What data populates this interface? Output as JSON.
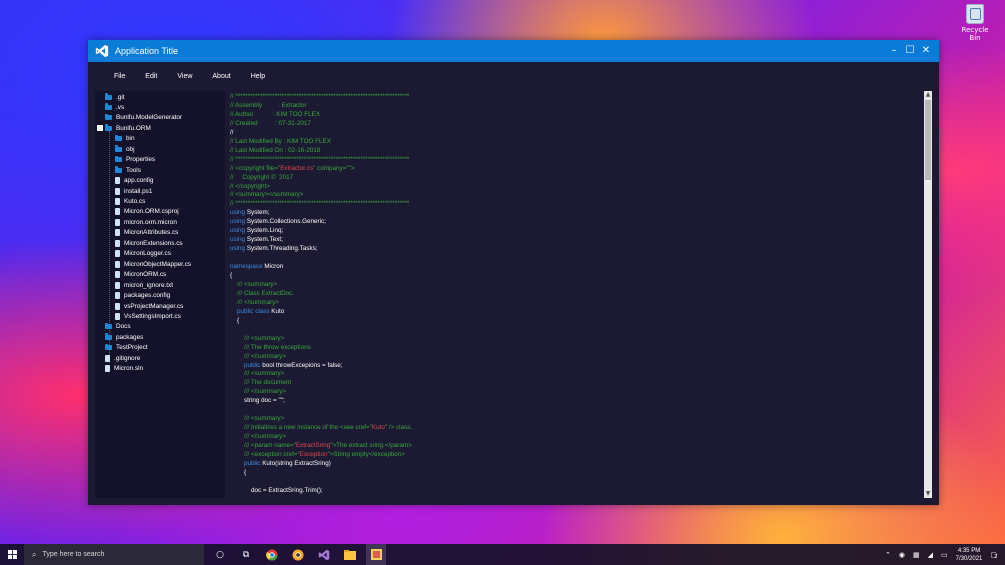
{
  "desktop": {
    "recycle_bin_label": "Recycle Bin"
  },
  "window": {
    "title": "Application Title",
    "icon": "visual-studio-icon",
    "controls": [
      "minimize-icon",
      "maximize-icon",
      "close-icon"
    ]
  },
  "menu": [
    "File",
    "Edit",
    "View",
    "About",
    "Help"
  ],
  "tree": [
    {
      "label": ".git",
      "type": "folder",
      "level": 0
    },
    {
      "label": ".vs",
      "type": "folder",
      "level": 0
    },
    {
      "label": "Bunifu.ModelGenerator",
      "type": "folder",
      "level": 0
    },
    {
      "label": "Bunifu.ORM",
      "type": "folder",
      "level": 0,
      "expanded": true
    },
    {
      "label": "bin",
      "type": "folder",
      "level": 1
    },
    {
      "label": "obj",
      "type": "folder",
      "level": 1
    },
    {
      "label": "Properties",
      "type": "folder",
      "level": 1
    },
    {
      "label": "Tools",
      "type": "folder",
      "level": 1
    },
    {
      "label": "app.config",
      "type": "file",
      "level": 1
    },
    {
      "label": "install.ps1",
      "type": "file",
      "level": 1
    },
    {
      "label": "Kuto.cs",
      "type": "file",
      "level": 1
    },
    {
      "label": "Micron.ORM.csproj",
      "type": "file",
      "level": 1
    },
    {
      "label": "micron.orm.micron",
      "type": "file",
      "level": 1
    },
    {
      "label": "MicronAttributes.cs",
      "type": "file",
      "level": 1
    },
    {
      "label": "MicronExtensions.cs",
      "type": "file",
      "level": 1
    },
    {
      "label": "MicronLogger.cs",
      "type": "file",
      "level": 1
    },
    {
      "label": "MicronObjectMapper.cs",
      "type": "file",
      "level": 1
    },
    {
      "label": "MicronORM.cs",
      "type": "file",
      "level": 1
    },
    {
      "label": "micron_ignore.txt",
      "type": "file",
      "level": 1
    },
    {
      "label": "packages.config",
      "type": "file",
      "level": 1
    },
    {
      "label": "vsProjectManager.cs",
      "type": "file",
      "level": 1
    },
    {
      "label": "VsSettingsImport.cs",
      "type": "file",
      "level": 1
    },
    {
      "label": "Docs",
      "type": "folder",
      "level": 0
    },
    {
      "label": "packages",
      "type": "folder",
      "level": 0
    },
    {
      "label": "TestProject",
      "type": "folder",
      "level": 0
    },
    {
      "label": ".gitignore",
      "type": "file",
      "level": 0
    },
    {
      "label": "Micron.sln",
      "type": "file",
      "level": 0
    }
  ],
  "code": [
    [
      [
        "c",
        "// ***********************************************************************"
      ]
    ],
    [
      [
        "c",
        "// Assembly         : Extractor"
      ]
    ],
    [
      [
        "c",
        "// Author           : KIM TOO FLEX"
      ]
    ],
    [
      [
        "c",
        "// Created          : 07-31-2017"
      ]
    ],
    [
      [
        "t",
        "//"
      ]
    ],
    [
      [
        "c",
        "// Last Modified By : KIM TOO FLEX"
      ]
    ],
    [
      [
        "c",
        "// Last Modified On : 02-16-2018"
      ]
    ],
    [
      [
        "c",
        "// ***********************************************************************"
      ]
    ],
    [
      [
        "c",
        "// <copyright file=\""
      ],
      [
        "s",
        "Extractor.cs"
      ],
      [
        "c",
        "\" company=\"\">"
      ]
    ],
    [
      [
        "c",
        "//     Copyright ©  2017"
      ]
    ],
    [
      [
        "c",
        "// </copyright>"
      ]
    ],
    [
      [
        "c",
        "// <summary></summary>"
      ]
    ],
    [
      [
        "c",
        "// ***********************************************************************"
      ]
    ],
    [
      [
        "k",
        "using "
      ],
      [
        "t",
        "System;"
      ]
    ],
    [
      [
        "k",
        "using "
      ],
      [
        "t",
        "System.Collections.Generic;"
      ]
    ],
    [
      [
        "k",
        "using "
      ],
      [
        "t",
        "System.Linq;"
      ]
    ],
    [
      [
        "k",
        "using "
      ],
      [
        "t",
        "System.Text;"
      ]
    ],
    [
      [
        "k",
        "using "
      ],
      [
        "t",
        "System.Threading.Tasks;"
      ]
    ],
    [],
    [
      [
        "k",
        "namespace "
      ],
      [
        "t",
        "Micron"
      ]
    ],
    [
      [
        "t",
        "{"
      ]
    ],
    [
      [
        "c",
        "    /// <summary>"
      ]
    ],
    [
      [
        "c",
        "    /// Class ExtractDoc."
      ]
    ],
    [
      [
        "c",
        "    /// </summary>"
      ]
    ],
    [
      [
        "k",
        "    public class "
      ],
      [
        "t",
        "Kuto"
      ]
    ],
    [
      [
        "t",
        "    {"
      ]
    ],
    [],
    [
      [
        "c",
        "        /// <summary>"
      ]
    ],
    [
      [
        "c",
        "        /// The throw exceptions"
      ]
    ],
    [
      [
        "c",
        "        /// </summary>"
      ]
    ],
    [
      [
        "k",
        "        public "
      ],
      [
        "t",
        "bool throwExcepions = false;"
      ]
    ],
    [
      [
        "c",
        "        /// <summary>"
      ]
    ],
    [
      [
        "c",
        "        /// The document"
      ]
    ],
    [
      [
        "c",
        "        /// </summary>"
      ]
    ],
    [
      [
        "t",
        "        string doc = \"\";"
      ]
    ],
    [],
    [
      [
        "c",
        "        /// <summary>"
      ]
    ],
    [
      [
        "c",
        "        /// Initializes a new instance of the <see cref=\""
      ],
      [
        "s",
        "Kuto"
      ],
      [
        "c",
        "\" /> class."
      ]
    ],
    [
      [
        "c",
        "        /// </summary>"
      ]
    ],
    [
      [
        "c",
        "        /// <param name=\""
      ],
      [
        "s",
        "ExtractSring"
      ],
      [
        "c",
        "\">The extract sring.</param>"
      ]
    ],
    [
      [
        "c",
        "        /// <exception cref=\""
      ],
      [
        "s",
        "Exception"
      ],
      [
        "c",
        "\">String empty</exception>"
      ]
    ],
    [
      [
        "k",
        "        public "
      ],
      [
        "t",
        "Kuto(string ExtractSring)"
      ]
    ],
    [
      [
        "t",
        "        {"
      ]
    ],
    [],
    [
      [
        "t",
        "            doc = ExtractSring.Trim();"
      ]
    ]
  ],
  "taskbar": {
    "search_placeholder": "Type here to search",
    "apps": [
      "cortana-icon",
      "task-view-icon",
      "chrome-icon",
      "chrome-canary-icon",
      "visual-studio-icon",
      "file-explorer-icon",
      "app-icon"
    ],
    "time": "4:35 PM",
    "date": "7/30/2021",
    "notification_count": "2"
  }
}
